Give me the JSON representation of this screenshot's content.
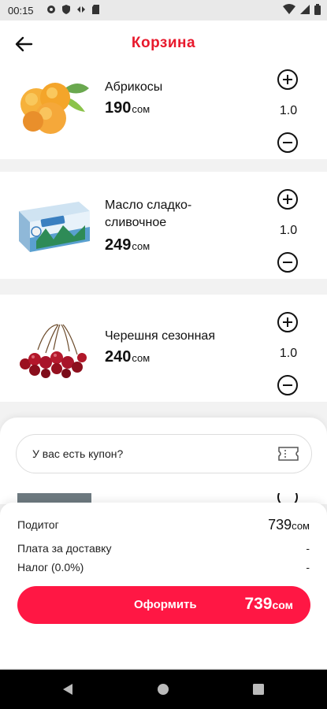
{
  "status_bar": {
    "time": "00:15",
    "icons": [
      "gear-icon",
      "shield-icon",
      "sync-icon",
      "sd-card-icon",
      "wifi-icon",
      "signal-icon",
      "battery-icon"
    ]
  },
  "app_bar": {
    "title": "Корзина",
    "back_icon": "arrow-left-icon"
  },
  "cart": {
    "items": [
      {
        "name": "Абрикосы",
        "price": "190",
        "currency": "сом",
        "quantity": "1.0",
        "image": "apricots"
      },
      {
        "name": "Масло сладко-сливочное",
        "price": "249",
        "currency": "сом",
        "quantity": "1.0",
        "image": "butter-package"
      },
      {
        "name": "Черешня сезонная",
        "price": "240",
        "currency": "сом",
        "quantity": "1.0",
        "image": "cherries"
      }
    ]
  },
  "coupon": {
    "placeholder": "У вас есть купон?",
    "icon": "ticket-icon"
  },
  "summary": {
    "subtotal_label": "Подитог",
    "subtotal_value": "739",
    "subtotal_currency": "сом",
    "delivery_label": "Плата за доставку",
    "delivery_value": "-",
    "tax_label": "Налог (0.0%)",
    "tax_value": "-"
  },
  "checkout": {
    "label": "Оформить",
    "amount": "739",
    "currency": "сом"
  },
  "colors": {
    "accent": "#e8192c",
    "button": "#ff1744"
  }
}
